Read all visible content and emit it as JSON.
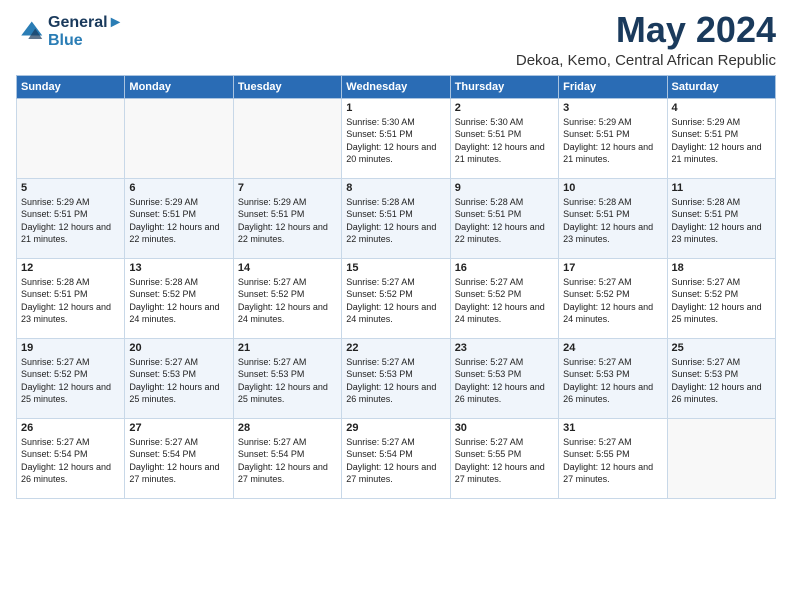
{
  "logo": {
    "line1": "General",
    "line2": "Blue"
  },
  "title": "May 2024",
  "subtitle": "Dekoa, Kemo, Central African Republic",
  "header_days": [
    "Sunday",
    "Monday",
    "Tuesday",
    "Wednesday",
    "Thursday",
    "Friday",
    "Saturday"
  ],
  "weeks": [
    [
      {
        "day": "",
        "sunrise": "",
        "sunset": "",
        "daylight": "",
        "empty": true
      },
      {
        "day": "",
        "sunrise": "",
        "sunset": "",
        "daylight": "",
        "empty": true
      },
      {
        "day": "",
        "sunrise": "",
        "sunset": "",
        "daylight": "",
        "empty": true
      },
      {
        "day": "1",
        "sunrise": "Sunrise: 5:30 AM",
        "sunset": "Sunset: 5:51 PM",
        "daylight": "Daylight: 12 hours and 20 minutes."
      },
      {
        "day": "2",
        "sunrise": "Sunrise: 5:30 AM",
        "sunset": "Sunset: 5:51 PM",
        "daylight": "Daylight: 12 hours and 21 minutes."
      },
      {
        "day": "3",
        "sunrise": "Sunrise: 5:29 AM",
        "sunset": "Sunset: 5:51 PM",
        "daylight": "Daylight: 12 hours and 21 minutes."
      },
      {
        "day": "4",
        "sunrise": "Sunrise: 5:29 AM",
        "sunset": "Sunset: 5:51 PM",
        "daylight": "Daylight: 12 hours and 21 minutes."
      }
    ],
    [
      {
        "day": "5",
        "sunrise": "Sunrise: 5:29 AM",
        "sunset": "Sunset: 5:51 PM",
        "daylight": "Daylight: 12 hours and 21 minutes."
      },
      {
        "day": "6",
        "sunrise": "Sunrise: 5:29 AM",
        "sunset": "Sunset: 5:51 PM",
        "daylight": "Daylight: 12 hours and 22 minutes."
      },
      {
        "day": "7",
        "sunrise": "Sunrise: 5:29 AM",
        "sunset": "Sunset: 5:51 PM",
        "daylight": "Daylight: 12 hours and 22 minutes."
      },
      {
        "day": "8",
        "sunrise": "Sunrise: 5:28 AM",
        "sunset": "Sunset: 5:51 PM",
        "daylight": "Daylight: 12 hours and 22 minutes."
      },
      {
        "day": "9",
        "sunrise": "Sunrise: 5:28 AM",
        "sunset": "Sunset: 5:51 PM",
        "daylight": "Daylight: 12 hours and 22 minutes."
      },
      {
        "day": "10",
        "sunrise": "Sunrise: 5:28 AM",
        "sunset": "Sunset: 5:51 PM",
        "daylight": "Daylight: 12 hours and 23 minutes."
      },
      {
        "day": "11",
        "sunrise": "Sunrise: 5:28 AM",
        "sunset": "Sunset: 5:51 PM",
        "daylight": "Daylight: 12 hours and 23 minutes."
      }
    ],
    [
      {
        "day": "12",
        "sunrise": "Sunrise: 5:28 AM",
        "sunset": "Sunset: 5:51 PM",
        "daylight": "Daylight: 12 hours and 23 minutes."
      },
      {
        "day": "13",
        "sunrise": "Sunrise: 5:28 AM",
        "sunset": "Sunset: 5:52 PM",
        "daylight": "Daylight: 12 hours and 24 minutes."
      },
      {
        "day": "14",
        "sunrise": "Sunrise: 5:27 AM",
        "sunset": "Sunset: 5:52 PM",
        "daylight": "Daylight: 12 hours and 24 minutes."
      },
      {
        "day": "15",
        "sunrise": "Sunrise: 5:27 AM",
        "sunset": "Sunset: 5:52 PM",
        "daylight": "Daylight: 12 hours and 24 minutes."
      },
      {
        "day": "16",
        "sunrise": "Sunrise: 5:27 AM",
        "sunset": "Sunset: 5:52 PM",
        "daylight": "Daylight: 12 hours and 24 minutes."
      },
      {
        "day": "17",
        "sunrise": "Sunrise: 5:27 AM",
        "sunset": "Sunset: 5:52 PM",
        "daylight": "Daylight: 12 hours and 24 minutes."
      },
      {
        "day": "18",
        "sunrise": "Sunrise: 5:27 AM",
        "sunset": "Sunset: 5:52 PM",
        "daylight": "Daylight: 12 hours and 25 minutes."
      }
    ],
    [
      {
        "day": "19",
        "sunrise": "Sunrise: 5:27 AM",
        "sunset": "Sunset: 5:52 PM",
        "daylight": "Daylight: 12 hours and 25 minutes."
      },
      {
        "day": "20",
        "sunrise": "Sunrise: 5:27 AM",
        "sunset": "Sunset: 5:53 PM",
        "daylight": "Daylight: 12 hours and 25 minutes."
      },
      {
        "day": "21",
        "sunrise": "Sunrise: 5:27 AM",
        "sunset": "Sunset: 5:53 PM",
        "daylight": "Daylight: 12 hours and 25 minutes."
      },
      {
        "day": "22",
        "sunrise": "Sunrise: 5:27 AM",
        "sunset": "Sunset: 5:53 PM",
        "daylight": "Daylight: 12 hours and 26 minutes."
      },
      {
        "day": "23",
        "sunrise": "Sunrise: 5:27 AM",
        "sunset": "Sunset: 5:53 PM",
        "daylight": "Daylight: 12 hours and 26 minutes."
      },
      {
        "day": "24",
        "sunrise": "Sunrise: 5:27 AM",
        "sunset": "Sunset: 5:53 PM",
        "daylight": "Daylight: 12 hours and 26 minutes."
      },
      {
        "day": "25",
        "sunrise": "Sunrise: 5:27 AM",
        "sunset": "Sunset: 5:53 PM",
        "daylight": "Daylight: 12 hours and 26 minutes."
      }
    ],
    [
      {
        "day": "26",
        "sunrise": "Sunrise: 5:27 AM",
        "sunset": "Sunset: 5:54 PM",
        "daylight": "Daylight: 12 hours and 26 minutes."
      },
      {
        "day": "27",
        "sunrise": "Sunrise: 5:27 AM",
        "sunset": "Sunset: 5:54 PM",
        "daylight": "Daylight: 12 hours and 27 minutes."
      },
      {
        "day": "28",
        "sunrise": "Sunrise: 5:27 AM",
        "sunset": "Sunset: 5:54 PM",
        "daylight": "Daylight: 12 hours and 27 minutes."
      },
      {
        "day": "29",
        "sunrise": "Sunrise: 5:27 AM",
        "sunset": "Sunset: 5:54 PM",
        "daylight": "Daylight: 12 hours and 27 minutes."
      },
      {
        "day": "30",
        "sunrise": "Sunrise: 5:27 AM",
        "sunset": "Sunset: 5:55 PM",
        "daylight": "Daylight: 12 hours and 27 minutes."
      },
      {
        "day": "31",
        "sunrise": "Sunrise: 5:27 AM",
        "sunset": "Sunset: 5:55 PM",
        "daylight": "Daylight: 12 hours and 27 minutes."
      },
      {
        "day": "",
        "sunrise": "",
        "sunset": "",
        "daylight": "",
        "empty": true
      }
    ]
  ]
}
